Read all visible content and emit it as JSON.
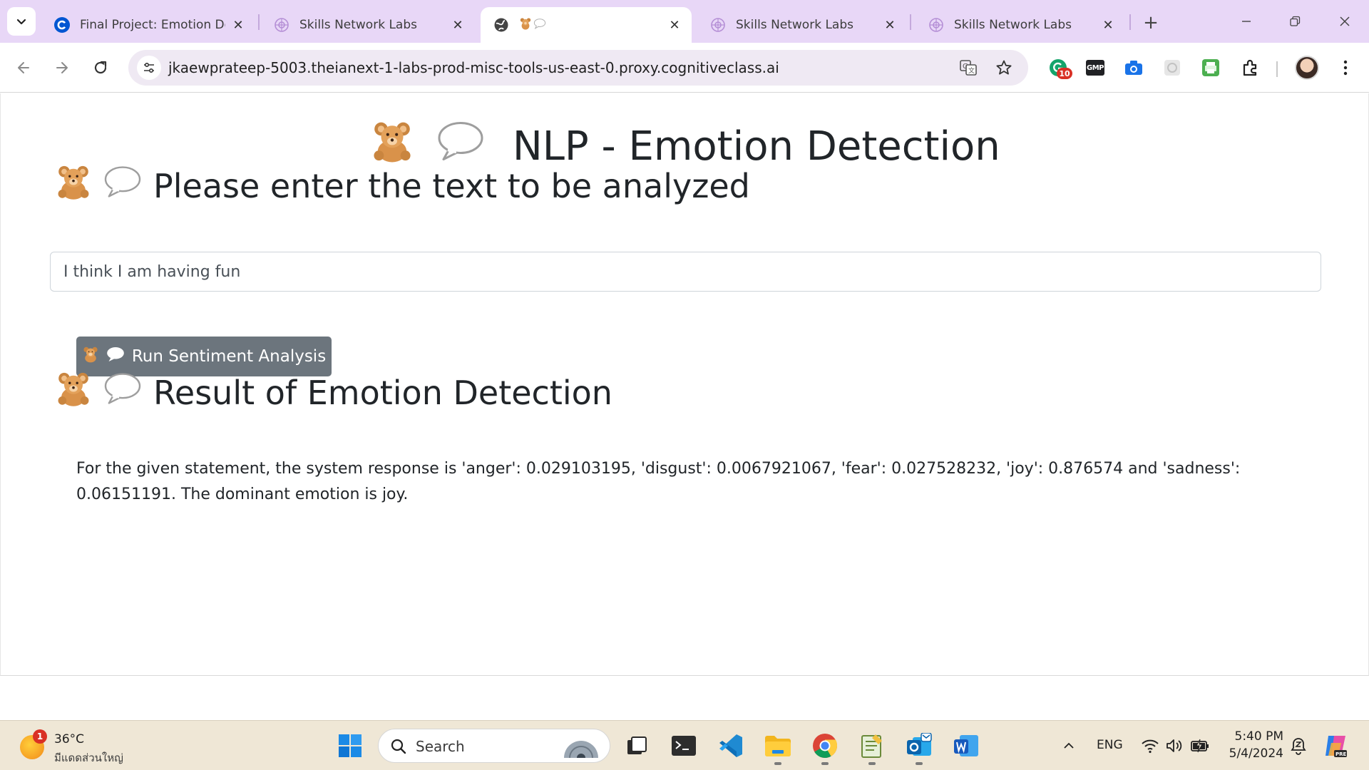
{
  "browser": {
    "tabs": [
      {
        "title": "Final Project: Emotion De",
        "active": false
      },
      {
        "title": "Skills Network Labs",
        "active": false
      },
      {
        "title": "",
        "active": true
      },
      {
        "title": "Skills Network Labs",
        "active": false
      },
      {
        "title": "Skills Network Labs",
        "active": false
      }
    ],
    "url": "jkaewprateep-5003.theianext-1-labs-prod-misc-tools-us-east-0.proxy.cognitiveclass.ai",
    "extensions": [
      {
        "name": "grammarly-extension-icon",
        "badge": "10"
      },
      {
        "name": "gmp-extension-icon",
        "label": "GMP"
      },
      {
        "name": "camera-extension-icon"
      },
      {
        "name": "grey-extension-icon"
      },
      {
        "name": "printer-extension-icon"
      },
      {
        "name": "puzzle-extensions-icon"
      }
    ]
  },
  "page": {
    "title": "NLP - Emotion Detection",
    "input_heading": "Please enter the text to be analyzed",
    "input_value": "I think I am having fun",
    "button_label": "Run Sentiment Analysis",
    "result_heading": "Result of Emotion Detection",
    "result_text": "For the given statement, the system response is 'anger': 0.029103195, 'disgust': 0.0067921067, 'fear': 0.027528232, 'joy': 0.876574 and 'sadness': 0.06151191. The dominant emotion is joy."
  },
  "taskbar": {
    "weather": {
      "badge": "1",
      "temp": "36°C",
      "desc": "มีแดดส่วนใหญ่"
    },
    "search_label": "Search",
    "language": "ENG",
    "time": "5:40 PM",
    "date": "5/4/2024"
  },
  "colors": {
    "tab_strip": "#e8d7f7",
    "button_bg": "#6c757d",
    "taskbar": "#efe7d6"
  }
}
